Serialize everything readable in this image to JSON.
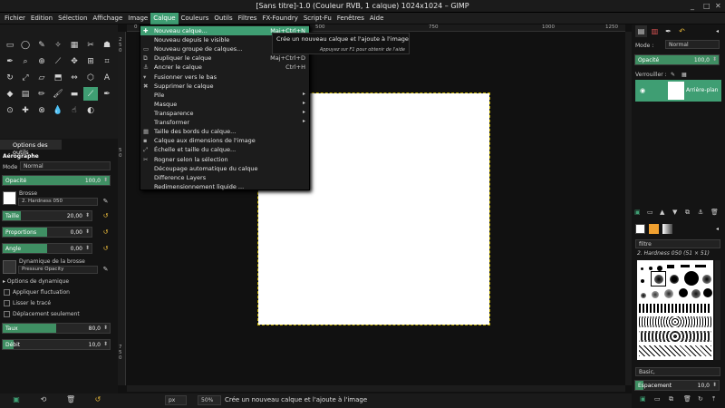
{
  "window": {
    "title": "[Sans titre]-1.0 (Couleur RVB, 1 calque) 1024x1024 – GIMP",
    "controls": [
      "_",
      "□",
      "✕"
    ]
  },
  "menubar": [
    "Fichier",
    "Edition",
    "Sélection",
    "Affichage",
    "Image",
    "Calque",
    "Couleurs",
    "Outils",
    "Filtres",
    "FX-Foundry",
    "Script-Fu",
    "Fenêtres",
    "Aide"
  ],
  "active_menu": "Calque",
  "menu": {
    "items": [
      {
        "label": "Nouveau calque...",
        "shortcut": "Maj+Ctrl+N",
        "icon": "✚"
      },
      {
        "label": "Nouveau depuis le visible",
        "shortcut": "",
        "icon": ""
      },
      {
        "label": "Nouveau groupe de calques...",
        "shortcut": "",
        "icon": "▭"
      },
      {
        "label": "Dupliquer le calque",
        "shortcut": "Maj+Ctrl+D",
        "icon": "⧉"
      },
      {
        "label": "Ancrer le calque",
        "shortcut": "Ctrl+H",
        "icon": "⚓"
      },
      {
        "label": "Fusionner vers le bas",
        "shortcut": "",
        "icon": "▾"
      },
      {
        "label": "Supprimer le calque",
        "shortcut": "",
        "icon": "✖"
      },
      {
        "label": "Pile",
        "shortcut": "",
        "icon": "",
        "submenu": true
      },
      {
        "label": "Masque",
        "shortcut": "",
        "icon": "",
        "submenu": true
      },
      {
        "label": "Transparence",
        "shortcut": "",
        "icon": "",
        "submenu": true
      },
      {
        "label": "Transformer",
        "shortcut": "",
        "icon": "",
        "submenu": true
      },
      {
        "label": "Taille des bords du calque...",
        "shortcut": "",
        "icon": "▦"
      },
      {
        "label": "Calque aux dimensions de l'image",
        "shortcut": "",
        "icon": "▪"
      },
      {
        "label": "Échelle et taille du calque...",
        "shortcut": "",
        "icon": "⤢"
      },
      {
        "label": "Rogner selon la sélection",
        "shortcut": "",
        "icon": "✂"
      },
      {
        "label": "Découpage automatique du calque",
        "shortcut": "",
        "icon": ""
      },
      {
        "label": "Difference Layers",
        "shortcut": "",
        "icon": ""
      },
      {
        "label": "Redimensionnement liquide ...",
        "shortcut": "",
        "icon": ""
      }
    ]
  },
  "tooltip": {
    "text": "Crée un nouveau calque et l'ajoute à l'image",
    "hint": "Appuyez sur F1 pour obtenir de l'aide"
  },
  "tool_options": {
    "tab_label": "Options des outils",
    "tool_name": "Aérographe",
    "mode_label": "Mode :",
    "mode_value": "Normal",
    "opacity": {
      "label": "Opacité",
      "value": "100,0",
      "fraction": 1.0
    },
    "brush_label": "Brosse",
    "brush_value": "2. Hardness 050",
    "size": {
      "label": "Taille",
      "value": "20,00",
      "fraction": 0.2
    },
    "ratio": {
      "label": "Proportions",
      "value": "0,00",
      "fraction": 0.5
    },
    "angle": {
      "label": "Angle",
      "value": "0,00",
      "fraction": 0.5
    },
    "dynamics_label": "Dynamique de la brosse",
    "dynamics_value": "Pressure Opacity",
    "dynamics_options": "Options de dynamique",
    "apply_jitter": "Appliquer fluctuation",
    "smooth_stroke": "Lisser le tracé",
    "incremental": "Déplacement seulement",
    "rate": {
      "label": "Taux",
      "value": "80,0",
      "fraction": 0.5
    },
    "flow": {
      "label": "Débit",
      "value": "10,0",
      "fraction": 0.1
    }
  },
  "rulers": {
    "top": [
      "0",
      "250",
      "500",
      "750",
      "1000",
      "1250"
    ],
    "left": [
      "2",
      "5",
      "0",
      "5",
      "0",
      "7",
      "5",
      "0"
    ]
  },
  "statusbar": {
    "unit": "px",
    "zoom": "50%",
    "message": "Crée un nouveau calque et l'ajoute à l'image"
  },
  "layers": {
    "mode_label": "Mode :",
    "mode_value": "Normal",
    "opacity_label": "Opacité",
    "opacity_value": "100,0",
    "lock_label": "Verrouiller :",
    "layer_name": "Arrière-plan"
  },
  "brushes": {
    "filter_label": "filtre",
    "title": "2. Hardness 050 (51 × 51)",
    "preset": "Basic,",
    "spacing_label": "Espacement",
    "spacing_value": "10,0"
  },
  "colors": {
    "accent": "#3f9e73",
    "bg": "#141414"
  }
}
